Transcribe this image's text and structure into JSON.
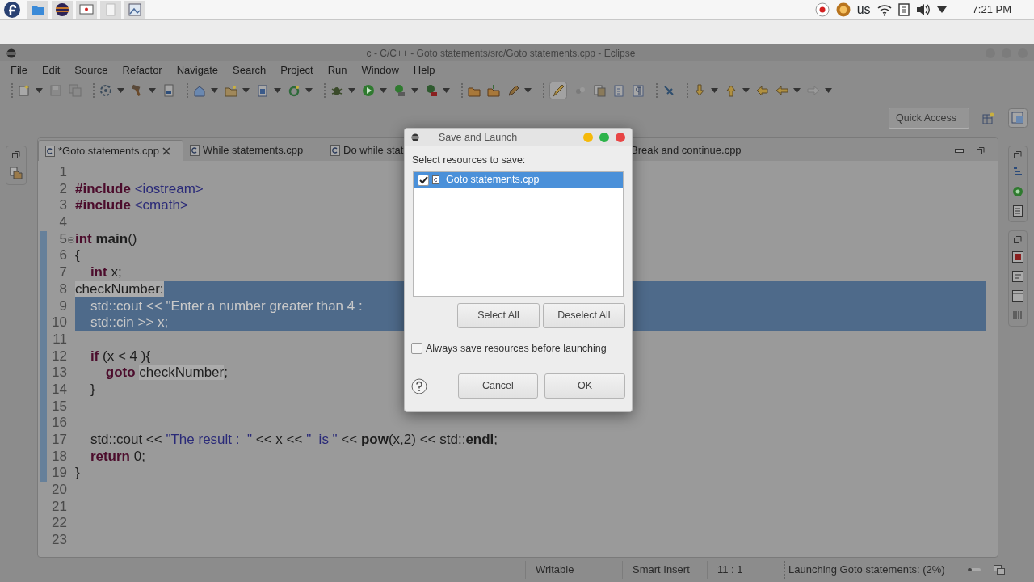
{
  "system_bar": {
    "keyboard_layout": "us",
    "clock": "7:21 PM"
  },
  "window": {
    "title": "c - C/C++ - Goto statements/src/Goto statements.cpp - Eclipse"
  },
  "menu": [
    "File",
    "Edit",
    "Source",
    "Refactor",
    "Navigate",
    "Search",
    "Project",
    "Run",
    "Window",
    "Help"
  ],
  "quick_access": {
    "placeholder": "Quick Access"
  },
  "editor_tabs": [
    {
      "label": "*Goto statements.cpp",
      "selected": true,
      "icon": true
    },
    {
      "label": "While statements.cpp",
      "selected": false,
      "icon": true
    },
    {
      "label": "Do while stat",
      "selected": false,
      "icon": true
    },
    {
      "label": "Break and continue.cpp",
      "selected": false,
      "icon": false
    }
  ],
  "code_lines": [
    {
      "number": "1",
      "selected": false
    },
    {
      "number": "2",
      "selected": false,
      "tokens": [
        {
          "text": "#include",
          "kind": "keyword"
        },
        {
          "text": " <iostream>",
          "kind": "string"
        }
      ]
    },
    {
      "number": "3",
      "selected": false,
      "tokens": [
        {
          "text": "#include",
          "kind": "keyword"
        },
        {
          "text": " <cmath>",
          "kind": "string"
        }
      ]
    },
    {
      "number": "4",
      "selected": false
    },
    {
      "number": "5",
      "selected": false,
      "foldable": true,
      "tokens": [
        {
          "text": "int",
          "kind": "keyword"
        },
        {
          "text": " main",
          "kind": "bold"
        },
        {
          "text": "()",
          "kind": "plain"
        }
      ]
    },
    {
      "number": "6",
      "selected": false,
      "tokens": [
        {
          "text": "{",
          "kind": "plain"
        }
      ]
    },
    {
      "number": "7",
      "selected": false,
      "tokens": [
        {
          "text": "    int",
          "kind": "keyword"
        },
        {
          "text": " x;",
          "kind": "plain"
        }
      ]
    },
    {
      "number": "8",
      "selected": true,
      "tokens": [
        {
          "text": "checkNumber:",
          "kind": "occurrence"
        }
      ]
    },
    {
      "number": "9",
      "selected": true,
      "tokens": [
        {
          "text": "    std::cout << \"Enter a number greater than 4 :",
          "kind": "plain"
        }
      ]
    },
    {
      "number": "10",
      "selected": true,
      "tokens": [
        {
          "text": "    std::cin >> x;",
          "kind": "plain"
        }
      ]
    },
    {
      "number": "11",
      "selected": false
    },
    {
      "number": "12",
      "selected": false,
      "tokens": [
        {
          "text": "    if",
          "kind": "keyword"
        },
        {
          "text": " (x < 4 ){",
          "kind": "plain"
        }
      ]
    },
    {
      "number": "13",
      "selected": false,
      "tokens": [
        {
          "text": "        goto ",
          "kind": "keyword"
        },
        {
          "text": "checkNumber",
          "kind": "occurrence"
        },
        {
          "text": ";",
          "kind": "plain"
        }
      ]
    },
    {
      "number": "14",
      "selected": false,
      "tokens": [
        {
          "text": "    }",
          "kind": "plain"
        }
      ]
    },
    {
      "number": "15",
      "selected": false
    },
    {
      "number": "16",
      "selected": false
    },
    {
      "number": "17",
      "selected": false,
      "tokens": [
        {
          "text": "    std::cout << ",
          "kind": "plain"
        },
        {
          "text": "\"The result :  \"",
          "kind": "string"
        },
        {
          "text": " << x << ",
          "kind": "plain"
        },
        {
          "text": "\"  is \"",
          "kind": "string"
        },
        {
          "text": " << ",
          "kind": "plain"
        },
        {
          "text": "pow",
          "kind": "bold"
        },
        {
          "text": "(x,2) << std::",
          "kind": "plain"
        },
        {
          "text": "endl",
          "kind": "bold"
        },
        {
          "text": ";",
          "kind": "plain"
        }
      ]
    },
    {
      "number": "18",
      "selected": false,
      "tokens": [
        {
          "text": "    return",
          "kind": "keyword"
        },
        {
          "text": " 0;",
          "kind": "plain"
        }
      ]
    },
    {
      "number": "19",
      "selected": false,
      "tokens": [
        {
          "text": "}",
          "kind": "plain"
        }
      ]
    },
    {
      "number": "20",
      "selected": false
    },
    {
      "number": "21",
      "selected": false
    },
    {
      "number": "22",
      "selected": false
    },
    {
      "number": "23",
      "selected": false
    }
  ],
  "status_bar": {
    "items": [
      "Writable",
      "Smart Insert",
      "11 : 1"
    ],
    "progress_text": "Launching Goto statements: (2%)"
  },
  "dialog": {
    "title": "Save and Launch",
    "prompt": "Select resources to save:",
    "resources": [
      {
        "label": "Goto statements.cpp",
        "checked": true,
        "selected": true
      }
    ],
    "list_buttons": [
      "Select All",
      "Deselect All"
    ],
    "always_save": {
      "label": "Always save resources before launching",
      "checked": false
    },
    "buttons": [
      "Cancel",
      "OK"
    ]
  }
}
